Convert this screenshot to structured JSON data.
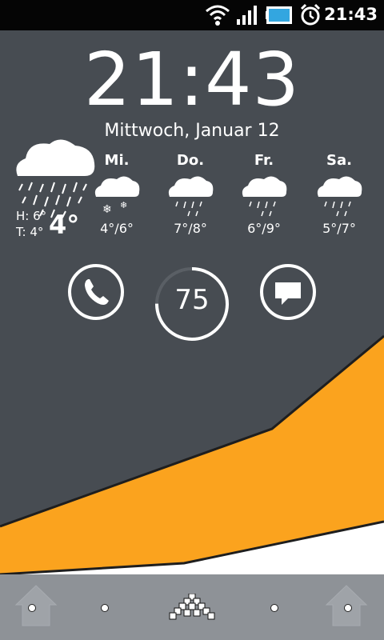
{
  "status_bar": {
    "time": "21:43",
    "icons": [
      "wifi-icon",
      "signal-icon",
      "battery-icon",
      "alarm-icon"
    ]
  },
  "clock": {
    "time": "21:43",
    "date": "Mittwoch, Januar 12"
  },
  "weather": {
    "today": {
      "high": "H: 6°",
      "low": "T: 4°",
      "current": "4°",
      "icon": "rain-cloud-icon"
    },
    "forecast": [
      {
        "day": "Mi.",
        "temps": "4°/6°",
        "icon": "snow-cloud-icon"
      },
      {
        "day": "Do.",
        "temps": "7°/8°",
        "icon": "rain-cloud-icon"
      },
      {
        "day": "Fr.",
        "temps": "6°/9°",
        "icon": "rain-cloud-icon"
      },
      {
        "day": "Sa.",
        "temps": "5°/7°",
        "icon": "rain-cloud-icon"
      }
    ]
  },
  "shortcuts": {
    "phone_icon": "phone-icon",
    "battery_percent": "75",
    "battery_level": 0.75,
    "messages_icon": "message-icon"
  },
  "dock": {
    "items": [
      "home-icon",
      "page-dot",
      "app-drawer-icon",
      "page-dot",
      "home-icon"
    ]
  },
  "colors": {
    "background": "#474c52",
    "accent": "#fba31e",
    "status_bar": "#050505",
    "dock": "#8e9297"
  }
}
